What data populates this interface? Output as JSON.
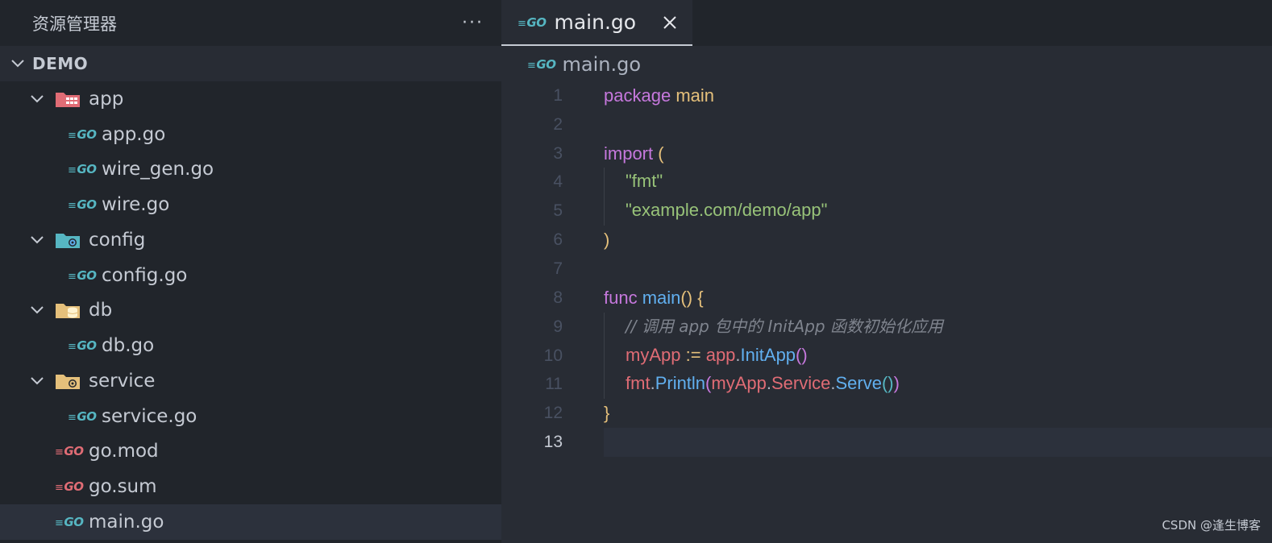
{
  "explorer": {
    "title": "资源管理器",
    "more": "···",
    "root": "DEMO",
    "items": [
      {
        "label": "app",
        "go": ""
      },
      {
        "label": "app.go",
        "go": "GO"
      },
      {
        "label": "wire_gen.go",
        "go": "GO"
      },
      {
        "label": "wire.go",
        "go": "GO"
      },
      {
        "label": "config",
        "go": ""
      },
      {
        "label": "config.go",
        "go": "GO"
      },
      {
        "label": "db",
        "go": ""
      },
      {
        "label": "db.go",
        "go": "GO"
      },
      {
        "label": "service",
        "go": ""
      },
      {
        "label": "service.go",
        "go": "GO"
      },
      {
        "label": "go.mod",
        "go": "GO"
      },
      {
        "label": "go.sum",
        "go": "GO"
      },
      {
        "label": "main.go",
        "go": "GO"
      }
    ]
  },
  "editor": {
    "tab": {
      "label": "main.go",
      "icon": "GO"
    },
    "breadcrumb": {
      "label": "main.go",
      "icon": "GO"
    },
    "line_numbers": [
      "1",
      "2",
      "3",
      "4",
      "5",
      "6",
      "7",
      "8",
      "9",
      "10",
      "11",
      "12",
      "13"
    ],
    "code": {
      "l1": {
        "kw": "package",
        "name": "main"
      },
      "l3": {
        "kw": "import",
        "paren": "("
      },
      "l4": {
        "str": "\"fmt\""
      },
      "l5": {
        "str": "\"example.com/demo/app\""
      },
      "l6": {
        "paren": ")"
      },
      "l8": {
        "kw": "func",
        "name": "main",
        "p1": "()",
        "brace": "{"
      },
      "l9": {
        "comment": "// 调用 app 包中的 InitApp 函数初始化应用"
      },
      "l10": {
        "var": "myApp",
        "op": ":=",
        "pkg": "app",
        "dot": ".",
        "fn": "InitApp",
        "p": "()"
      },
      "l11": {
        "pkg": "fmt",
        "dot": ".",
        "fn": "Println",
        "po": "(",
        "var": "myApp",
        "dot2": ".",
        "field": "Service",
        "dot3": ".",
        "fn2": "Serve",
        "pi": "()",
        "pc": ")"
      },
      "l12": {
        "brace": "}"
      }
    }
  },
  "watermark": "CSDN @逢生博客",
  "colors": {
    "background": "#282c34",
    "sidebar": "#21252b",
    "keyword": "#c678dd",
    "function": "#61afef",
    "string": "#98c379",
    "variable": "#e06c75",
    "go_icon_teal": "#56b6c2",
    "go_icon_red": "#e06c75"
  }
}
